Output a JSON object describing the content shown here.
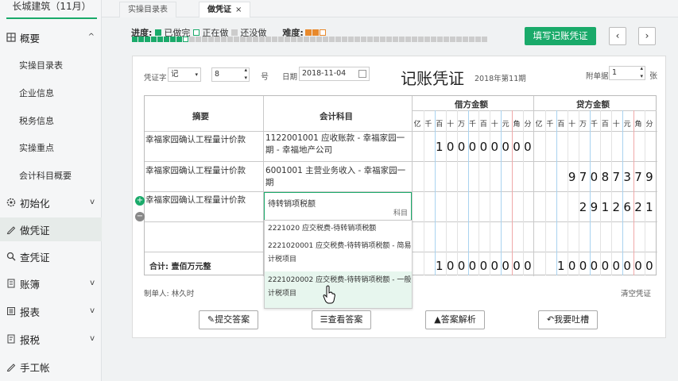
{
  "sidebar": {
    "company": "长城建筑（11月）",
    "menu": [
      {
        "label": "概要",
        "icon": "grid-icon"
      },
      {
        "label": "初始化",
        "icon": "gear-icon"
      },
      {
        "label": "做凭证",
        "icon": "pen-icon"
      },
      {
        "label": "查凭证",
        "icon": "search-icon"
      },
      {
        "label": "账簿",
        "icon": "book-icon"
      },
      {
        "label": "报表",
        "icon": "report-icon"
      },
      {
        "label": "报税",
        "icon": "tax-icon"
      },
      {
        "label": "手工帐",
        "icon": "hand-pen-icon"
      }
    ],
    "submenu": [
      "实操目录表",
      "企业信息",
      "税务信息",
      "实操重点",
      "会计科目概要"
    ],
    "expand_glyph": "^",
    "collapse_glyph": "v"
  },
  "tabs": [
    {
      "label": "实操目录表"
    },
    {
      "label": "做凭证",
      "close": "×"
    }
  ],
  "progress": {
    "label": "进度:",
    "legend_done": "已做完",
    "legend_doing": "正在做",
    "legend_todo": "还没做",
    "difficulty_label": "难度:",
    "colors": {
      "done": "#1aaa6a",
      "todo": "#cccccc",
      "difficulty": "#e8892b"
    }
  },
  "fill_button": "填写记账凭证",
  "voucher": {
    "word_label": "凭证字",
    "word_value": "记",
    "number_value": "8",
    "number_unit": "号",
    "date_label": "日期",
    "date_value": "2018-11-04",
    "title": "记账凭证",
    "period": "2018年第11期",
    "attach_label": "附单据",
    "attach_value": "1",
    "attach_unit": "张",
    "headers": {
      "summary": "摘要",
      "account": "会计科目",
      "debit": "借方金额",
      "credit": "贷方金额"
    },
    "digit_units": [
      "亿",
      "千",
      "百",
      "十",
      "万",
      "千",
      "百",
      "十",
      "元",
      "角",
      "分"
    ],
    "rows": [
      {
        "summary": "幸福家园确认工程量计价款",
        "account": "1122001001 应收账款 - 幸福家园一期 - 幸福地产公司",
        "debit": "100000000",
        "credit": ""
      },
      {
        "summary": "幸福家园确认工程量计价款",
        "account": "6001001 主营业务收入 - 幸福家园一期",
        "debit": "",
        "credit": "97087379"
      },
      {
        "summary": "幸福家园确认工程量计价款",
        "account": "待转销项税额",
        "account_hint": "科目",
        "debit": "",
        "credit": "2912621"
      }
    ],
    "total_label": "合计: 壹佰万元整",
    "total_debit": "100000000",
    "total_credit": "100000000",
    "maker_label": "制单人: 林久时",
    "clear_label": "清空凭证"
  },
  "dropdown": [
    "2221020 应交税费-待转销项税额",
    "2221020001 应交税费-待转销项税额 - 简易计税项目",
    "2221020002 应交税费-待转销项税额 - 一般计税项目"
  ],
  "buttons": {
    "submit": "提交答案",
    "view": "查看答案",
    "analysis": "答案解析",
    "feedback": "我要吐槽"
  }
}
